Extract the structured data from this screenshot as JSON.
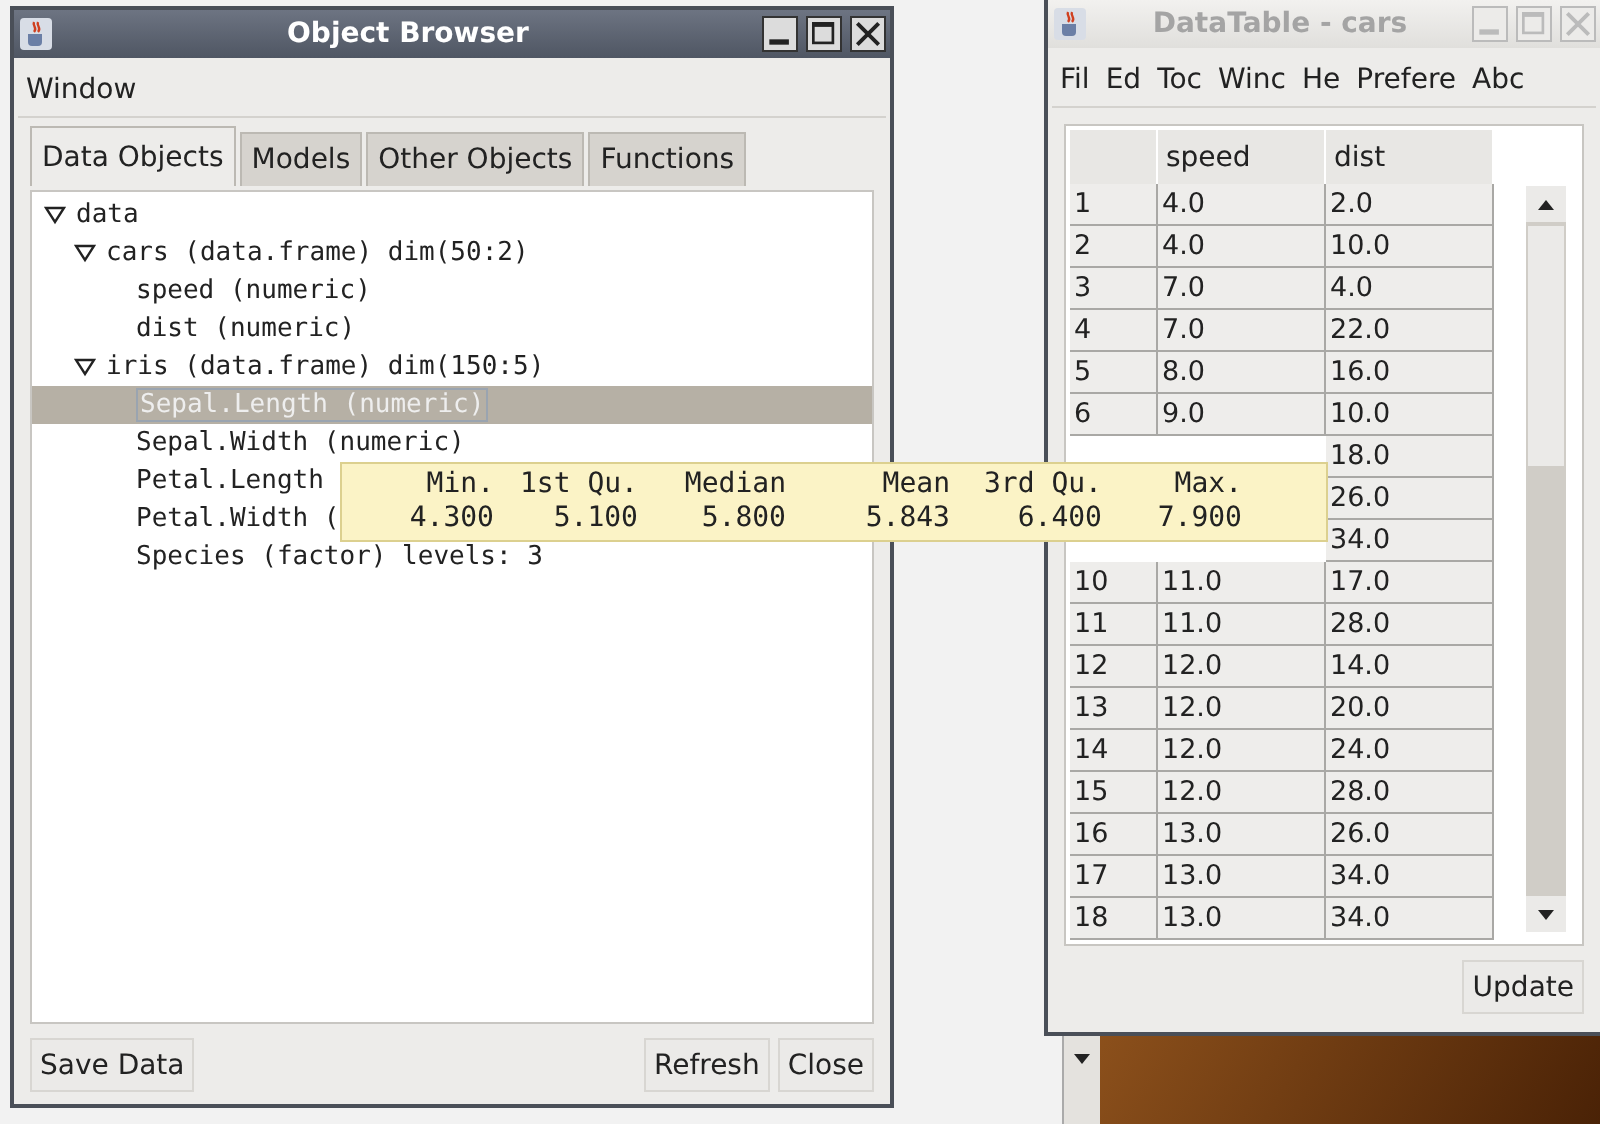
{
  "object_browser": {
    "title": "Object Browser",
    "active": true,
    "menu": [
      "Window"
    ],
    "tabs": [
      {
        "label": "Data Objects",
        "selected": true
      },
      {
        "label": "Models",
        "selected": false
      },
      {
        "label": "Other Objects",
        "selected": false
      },
      {
        "label": "Functions",
        "selected": false
      }
    ],
    "tree": [
      {
        "label": "data",
        "expanded": true,
        "selected": false,
        "children": [
          {
            "label": "cars (data.frame) dim(50:2)",
            "expanded": true,
            "selected": false,
            "children": [
              {
                "label": "speed (numeric)",
                "selected": false
              },
              {
                "label": "dist (numeric)",
                "selected": false
              }
            ]
          },
          {
            "label": "iris (data.frame) dim(150:5)",
            "expanded": true,
            "selected": false,
            "children": [
              {
                "label": "Sepal.Length (numeric)",
                "selected": true
              },
              {
                "label": "Sepal.Width (numeric)",
                "selected": false
              },
              {
                "label": "Petal.Length",
                "selected": false
              },
              {
                "label": "Petal.Width (",
                "selected": false
              },
              {
                "label": "Species (factor) levels: 3",
                "selected": false
              }
            ]
          }
        ]
      }
    ],
    "buttons_left": [
      "Save Data"
    ],
    "buttons_right": [
      "Refresh",
      "Close"
    ]
  },
  "data_table": {
    "title": "DataTable - cars",
    "active": false,
    "menu": [
      "Fil",
      "Ed",
      "Toc",
      "Winc",
      "He",
      "Prefere",
      "Abc"
    ],
    "columns": [
      "speed",
      "dist"
    ],
    "rows": [
      {
        "index": "1",
        "speed": "4.0",
        "dist": "2.0"
      },
      {
        "index": "2",
        "speed": "4.0",
        "dist": "10.0"
      },
      {
        "index": "3",
        "speed": "7.0",
        "dist": "4.0"
      },
      {
        "index": "4",
        "speed": "7.0",
        "dist": "22.0"
      },
      {
        "index": "5",
        "speed": "8.0",
        "dist": "16.0"
      },
      {
        "index": "6",
        "speed": "9.0",
        "dist": "10.0"
      },
      {
        "dist": "18.0"
      },
      {
        "dist": "26.0"
      },
      {
        "dist": "34.0"
      },
      {
        "index": "10",
        "speed": "11.0",
        "dist": "17.0"
      },
      {
        "index": "11",
        "speed": "11.0",
        "dist": "28.0"
      },
      {
        "index": "12",
        "speed": "12.0",
        "dist": "14.0"
      },
      {
        "index": "13",
        "speed": "12.0",
        "dist": "20.0"
      },
      {
        "index": "14",
        "speed": "12.0",
        "dist": "24.0"
      },
      {
        "index": "15",
        "speed": "12.0",
        "dist": "28.0"
      },
      {
        "index": "16",
        "speed": "13.0",
        "dist": "26.0"
      },
      {
        "index": "17",
        "speed": "13.0",
        "dist": "34.0"
      },
      {
        "index": "18",
        "speed": "13.0",
        "dist": "34.0"
      }
    ],
    "buttons": [
      "Update"
    ]
  },
  "tooltip": {
    "headers": [
      "Min.",
      "1st Qu.",
      "Median",
      "Mean",
      "3rd Qu.",
      "Max."
    ],
    "values": [
      "4.300",
      "5.100",
      "5.800",
      "5.843",
      "6.400",
      "7.900"
    ]
  }
}
